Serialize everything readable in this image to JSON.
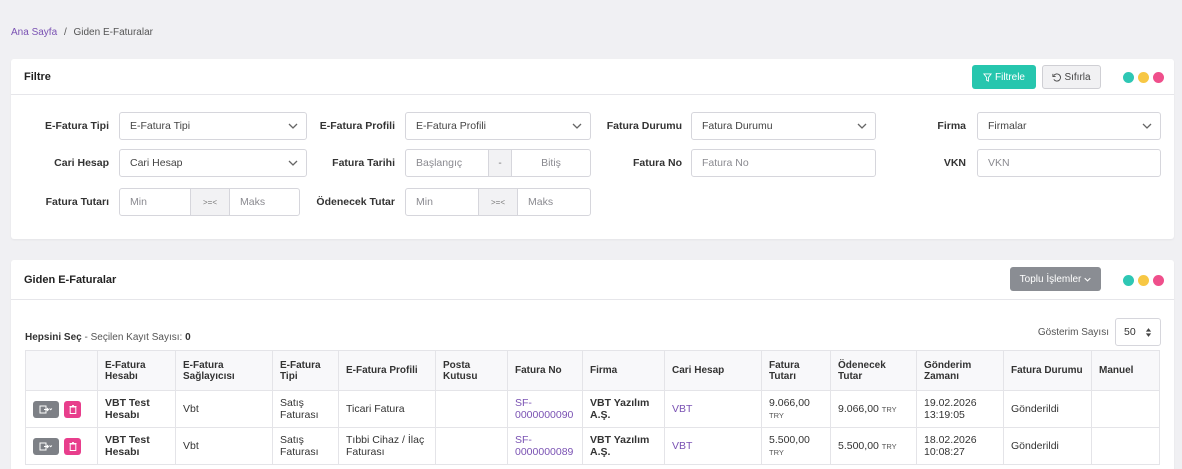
{
  "breadcrumb": {
    "home": "Ana Sayfa",
    "separator": "/",
    "current": "Giden E-Faturalar"
  },
  "filter_card": {
    "title": "Filtre",
    "filter_button": "Filtrele",
    "reset_button": "Sıfırla",
    "fields": {
      "efatura_tipi": {
        "label": "E-Fatura Tipi",
        "value": "E-Fatura Tipi"
      },
      "efatura_profili": {
        "label": "E-Fatura Profili",
        "value": "E-Fatura Profili"
      },
      "fatura_durumu": {
        "label": "Fatura Durumu",
        "value": "Fatura Durumu"
      },
      "firma": {
        "label": "Firma",
        "value": "Firmalar"
      },
      "cari_hesap": {
        "label": "Cari Hesap",
        "value": "Cari Hesap"
      },
      "fatura_tarihi": {
        "label": "Fatura Tarihi",
        "start": "Başlangıç",
        "sep": "-",
        "end": "Bitiş"
      },
      "fatura_no": {
        "label": "Fatura No",
        "placeholder": "Fatura No"
      },
      "vkn": {
        "label": "VKN",
        "placeholder": "VKN"
      },
      "fatura_tutari": {
        "label": "Fatura Tutarı",
        "min": "Min",
        "sep": ">=<",
        "max": "Maks"
      },
      "odenecek_tutar": {
        "label": "Ödenecek Tutar",
        "min": "Min",
        "sep": ">=<",
        "max": "Maks"
      }
    }
  },
  "list_card": {
    "title": "Giden E-Faturalar",
    "bulk_button": "Toplu İşlemler",
    "select_all": "Hepsini Seç",
    "selected_count_label": "- Seçilen Kayıt Sayısı:",
    "selected_count": "0",
    "display_count_label": "Gösterim Sayısı",
    "display_count_value": "50",
    "columns": [
      "",
      "E-Fatura Hesabı",
      "E-Fatura Sağlayıcısı",
      "E-Fatura Tipi",
      "E-Fatura Profili",
      "Posta Kutusu",
      "Fatura No",
      "Firma",
      "Cari Hesap",
      "Fatura Tutarı",
      "Ödenecek Tutar",
      "Gönderim Zamanı",
      "Fatura Durumu",
      "Manuel"
    ],
    "rows": [
      {
        "hesap": "VBT Test Hesabı",
        "saglayici": "Vbt",
        "tip": "Satış Faturası",
        "profil": "Ticari Fatura",
        "posta": "",
        "no": "SF-0000000090",
        "firma": "VBT Yazılım A.Ş.",
        "cari": "VBT",
        "tutar": "9.066,00",
        "odenecek": "9.066,00",
        "currency": "TRY",
        "zaman": "19.02.2026 13:19:05",
        "durum": "Gönderildi",
        "manuel": ""
      },
      {
        "hesap": "VBT Test Hesabı",
        "saglayici": "Vbt",
        "tip": "Satış Faturası",
        "profil": "Tıbbi Cihaz / İlaç Faturası",
        "posta": "",
        "no": "SF-0000000089",
        "firma": "VBT Yazılım A.Ş.",
        "cari": "VBT",
        "tutar": "5.500,00",
        "odenecek": "5.500,00",
        "currency": "TRY",
        "zaman": "18.02.2026 10:08:27",
        "durum": "Gönderildi",
        "manuel": ""
      }
    ]
  },
  "colors": {
    "accent": "#26c6ae",
    "link": "#7a52b3",
    "dot_teal": "#2ec7b4",
    "dot_yellow": "#f7c744",
    "dot_pink": "#ef4f8b",
    "delete": "#e83e8c"
  },
  "icons": [
    "filter-icon",
    "reset-icon",
    "chevron-down-icon",
    "export-icon",
    "delete-icon",
    "sort-icon"
  ]
}
